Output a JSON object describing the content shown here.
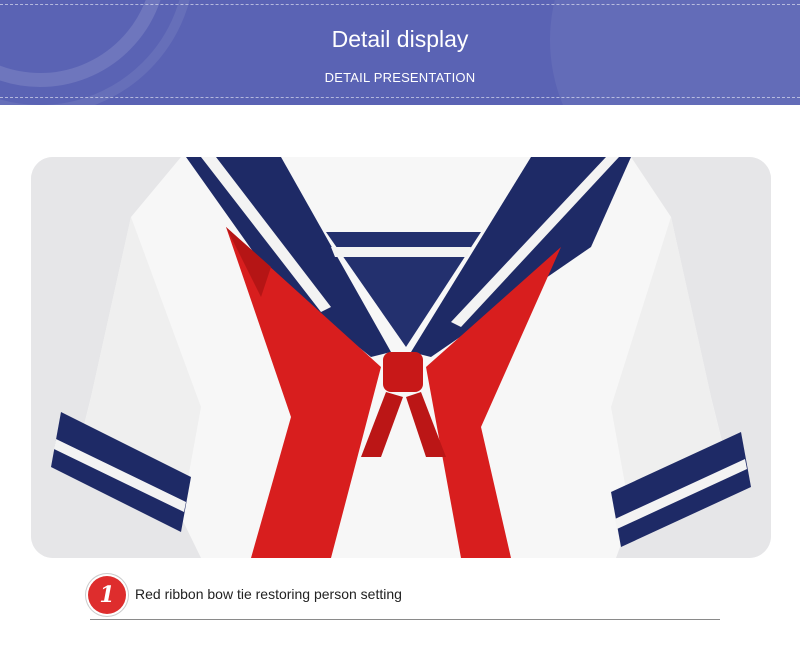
{
  "header": {
    "title": "Detail display",
    "subtitle": "DETAIL PRESENTATION"
  },
  "photo": {
    "subject": "sailor-uniform-detail"
  },
  "caption": {
    "number": "1",
    "text": "Red ribbon bow tie restoring person setting"
  },
  "colors": {
    "banner": "#5a63b4",
    "navy": "#1e2a66",
    "ribbon": "#d81e1e",
    "badge": "#de2d2d"
  }
}
